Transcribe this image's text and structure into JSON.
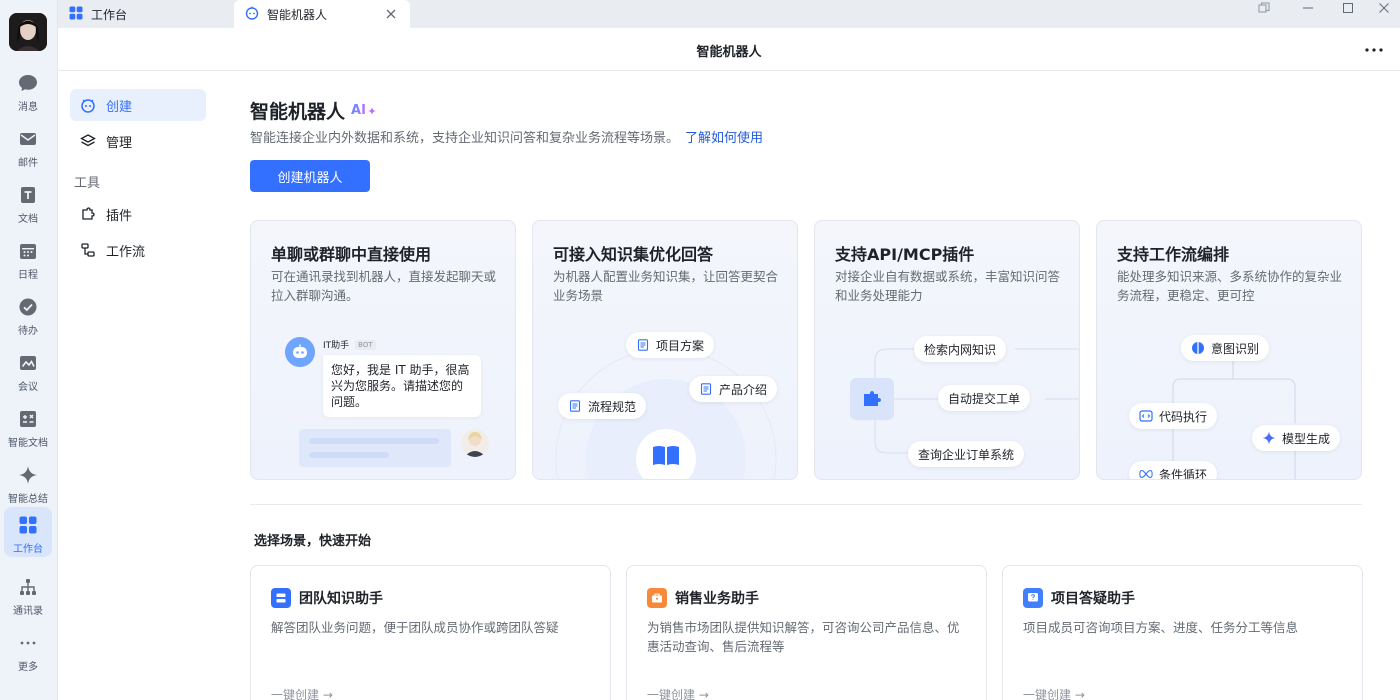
{
  "rail": {
    "items": [
      {
        "label": "消息",
        "icon": "message-icon"
      },
      {
        "label": "邮件",
        "icon": "mail-icon"
      },
      {
        "label": "文档",
        "icon": "doc-icon"
      },
      {
        "label": "日程",
        "icon": "calendar-icon"
      },
      {
        "label": "待办",
        "icon": "todo-icon"
      },
      {
        "label": "会议",
        "icon": "meeting-icon"
      },
      {
        "label": "智能文档",
        "icon": "smart-doc-icon"
      },
      {
        "label": "智能总结",
        "icon": "sparkle-icon"
      },
      {
        "label": "工作台",
        "icon": "workbench-icon",
        "active": true
      },
      {
        "label": "通讯录",
        "icon": "contacts-icon"
      },
      {
        "label": "更多",
        "icon": "more-icon"
      }
    ]
  },
  "tabs": [
    {
      "label": "工作台"
    },
    {
      "label": "智能机器人",
      "active": true
    }
  ],
  "header": {
    "title": "智能机器人"
  },
  "sidenav": {
    "create": "创建",
    "manage": "管理",
    "tools_section": "工具",
    "plugins": "插件",
    "workflow": "工作流"
  },
  "main": {
    "title": "智能机器人",
    "ai_badge": "AI",
    "description": "智能连接企业内外数据和系统，支持企业知识问答和复杂业务流程等场景。",
    "learn_link": "了解如何使用",
    "create_button": "创建机器人",
    "features": [
      {
        "title": "单聊或群聊中直接使用",
        "desc": "可在通讯录找到机器人，直接发起聊天或拉入群聊沟通。"
      },
      {
        "title": "可接入知识集优化回答",
        "desc": "为机器人配置业务知识集，让回答更契合业务场景"
      },
      {
        "title": "支持API/MCP插件",
        "desc": "对接企业自有数据或系统，丰富知识问答和业务处理能力"
      },
      {
        "title": "支持工作流编排",
        "desc": "能处理多知识来源、多系统协作的复杂业务流程，更稳定、更可控"
      }
    ],
    "chat_demo": {
      "bot_name": "IT助手",
      "bot_tag": "BOT",
      "message": "您好，我是 IT 助手，很高兴为您服务。请描述您的问题。"
    },
    "knowledge_pills": [
      "项目方案",
      "产品介绍",
      "流程规范"
    ],
    "plugin_pills": [
      "检索内网知识",
      "自动提交工单",
      "查询企业订单系统"
    ],
    "workflow_pills": [
      "意图识别",
      "代码执行",
      "模型生成",
      "条件循环"
    ],
    "scenes_title": "选择场景，快速开始",
    "scenes": [
      {
        "title": "团队知识助手",
        "desc": "解答团队业务问题，便于团队成员协作或跨团队答疑",
        "link": "一键创建 →",
        "color": "#3370ff"
      },
      {
        "title": "销售业务助手",
        "desc": "为销售市场团队提供知识解答，可咨询公司产品信息、优惠活动查询、售后流程等",
        "link": "一键创建 →",
        "color": "#f7893b"
      },
      {
        "title": "项目答疑助手",
        "desc": "项目成员可咨询项目方案、进度、任务分工等信息",
        "link": "一键创建 →",
        "color": "#4080ff"
      }
    ]
  },
  "colors": {
    "accent": "#3370ff",
    "link": "#245bdb",
    "rail_bg": "#eef2f9"
  }
}
